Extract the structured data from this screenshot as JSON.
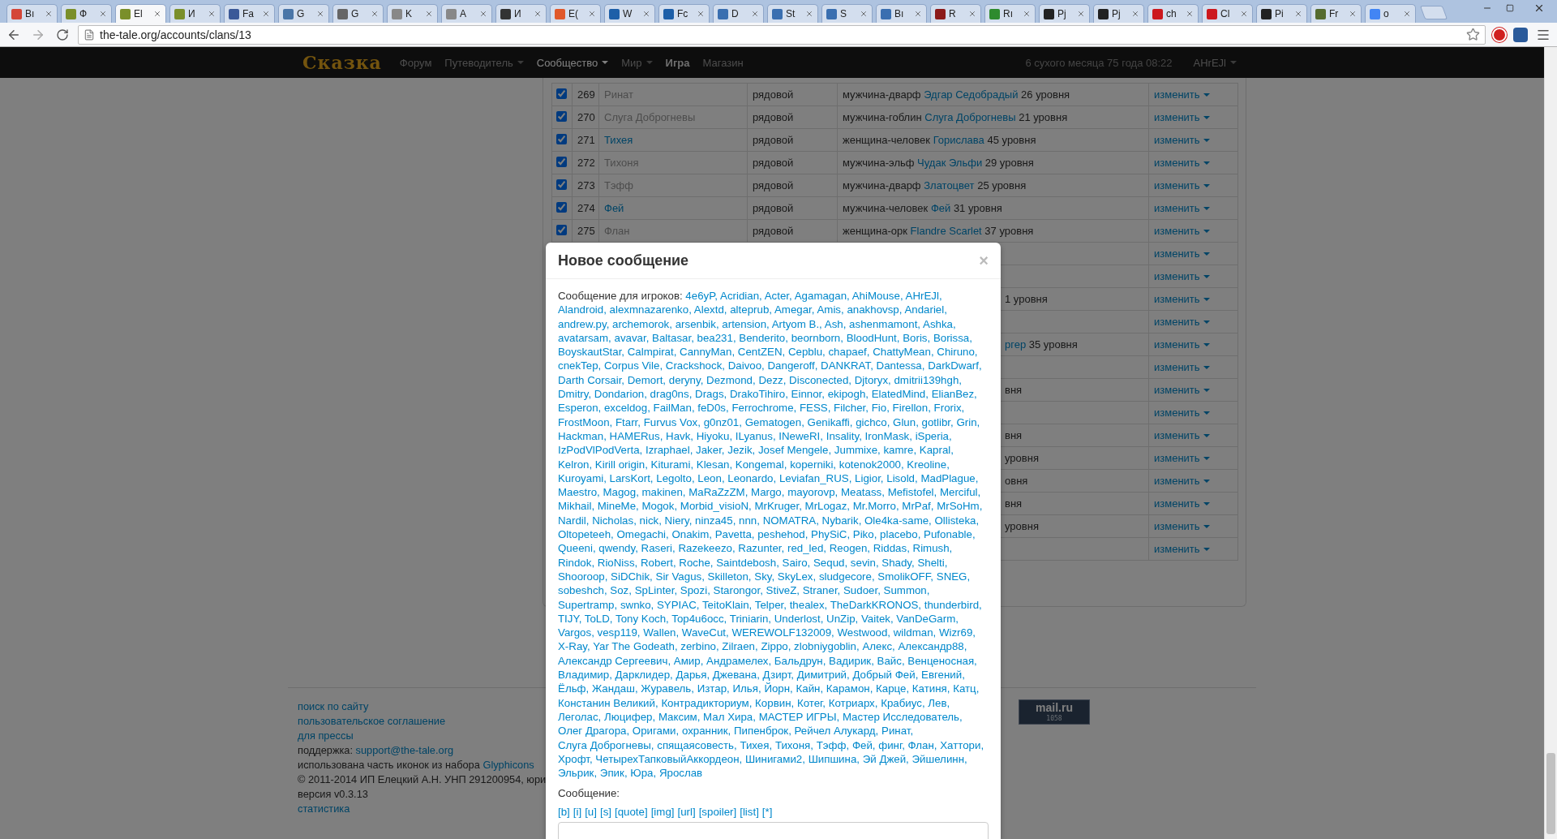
{
  "browser": {
    "tabs": [
      {
        "title": "Bı",
        "color": "#d44638",
        "selected": false
      },
      {
        "title": "Ф",
        "color": "#7a8f2a",
        "selected": false
      },
      {
        "title": "El",
        "color": "#7a8f2a",
        "selected": true
      },
      {
        "title": "И",
        "color": "#7a8f2a",
        "selected": false
      },
      {
        "title": "Fa",
        "color": "#3b5998",
        "selected": false
      },
      {
        "title": "G",
        "color": "#4a76a8",
        "selected": false
      },
      {
        "title": "G",
        "color": "#666666",
        "selected": false
      },
      {
        "title": "K",
        "color": "#888888",
        "selected": false
      },
      {
        "title": "A",
        "color": "#888888",
        "selected": false
      },
      {
        "title": "И",
        "color": "#333333",
        "selected": false
      },
      {
        "title": "E(",
        "color": "#e0582a",
        "selected": false
      },
      {
        "title": "W",
        "color": "#1d5fa8",
        "selected": false
      },
      {
        "title": "Fc",
        "color": "#1d5fa8",
        "selected": false
      },
      {
        "title": "D",
        "color": "#3a6fb0",
        "selected": false
      },
      {
        "title": "St",
        "color": "#3a6fb0",
        "selected": false
      },
      {
        "title": "S",
        "color": "#3a6fb0",
        "selected": false
      },
      {
        "title": "Bı",
        "color": "#3a6fb0",
        "selected": false
      },
      {
        "title": "R",
        "color": "#8b1a1a",
        "selected": false
      },
      {
        "title": "Rı",
        "color": "#2e8b2e",
        "selected": false
      },
      {
        "title": "Pj",
        "color": "#222222",
        "selected": false
      },
      {
        "title": "Pj",
        "color": "#222222",
        "selected": false
      },
      {
        "title": "ch",
        "color": "#cc181e",
        "selected": false
      },
      {
        "title": "Cl",
        "color": "#cc181e",
        "selected": false
      },
      {
        "title": "Pi",
        "color": "#222222",
        "selected": false
      },
      {
        "title": "Fr",
        "color": "#556b2f",
        "selected": false
      },
      {
        "title": "o",
        "color": "#4285f4",
        "selected": false
      }
    ],
    "url": "the-tale.org/accounts/clans/13"
  },
  "nav": {
    "logo": "Сказка",
    "items": [
      {
        "label": "Форум",
        "dropdown": false,
        "selected": false,
        "emphasis": false
      },
      {
        "label": "Путеводитель",
        "dropdown": true,
        "selected": false,
        "emphasis": false
      },
      {
        "label": "Сообщество",
        "dropdown": true,
        "selected": true,
        "emphasis": false
      },
      {
        "label": "Мир",
        "dropdown": true,
        "selected": false,
        "emphasis": false
      },
      {
        "label": "Игра",
        "dropdown": false,
        "selected": false,
        "emphasis": true
      },
      {
        "label": "Магазин",
        "dropdown": false,
        "selected": false,
        "emphasis": false
      }
    ],
    "date": "6 сухого месяца 75 года 08:22",
    "user": "AHrEJl"
  },
  "members": [
    {
      "kind": "full",
      "checked": true,
      "number": "269",
      "name": "Ринат",
      "linked": false,
      "rank": "рядовой",
      "race": "мужчина-дварф",
      "hero": "Эдгар Седобрадый",
      "level": "26 уровня",
      "action": "изменить"
    },
    {
      "kind": "full",
      "checked": true,
      "number": "270",
      "name": "Слуга Доброгневы",
      "linked": false,
      "rank": "рядовой",
      "race": "мужчина-гоблин",
      "hero": "Слуга Доброгневы",
      "level": "21 уровня",
      "action": "изменить"
    },
    {
      "kind": "full",
      "checked": true,
      "number": "271",
      "name": "Тихея",
      "linked": true,
      "rank": "рядовой",
      "race": "женщина-человек",
      "hero": "Горислава",
      "level": "45 уровня",
      "action": "изменить"
    },
    {
      "kind": "full",
      "checked": true,
      "number": "272",
      "name": "Тихоня",
      "linked": false,
      "rank": "рядовой",
      "race": "мужчина-эльф",
      "hero": "Чудак Эльфи",
      "level": "29 уровня",
      "action": "изменить"
    },
    {
      "kind": "full",
      "checked": true,
      "number": "273",
      "name": "Тэфф",
      "linked": false,
      "rank": "рядовой",
      "race": "мужчина-дварф",
      "hero": "Златоцвет",
      "level": "25 уровня",
      "action": "изменить"
    },
    {
      "kind": "full",
      "checked": true,
      "number": "274",
      "name": "Фей",
      "linked": true,
      "rank": "рядовой",
      "race": "мужчина-человек",
      "hero": "Фей",
      "level": "31 уровня",
      "action": "изменить"
    },
    {
      "kind": "full",
      "checked": true,
      "number": "275",
      "name": "Флан",
      "linked": false,
      "rank": "рядовой",
      "race": "женщина-орк",
      "hero": "Flandre Scarlet",
      "level": "37 уровня",
      "action": "изменить"
    },
    {
      "kind": "covered",
      "action": "изменить"
    },
    {
      "kind": "covered",
      "action": "изменить"
    },
    {
      "kind": "covered",
      "tail": "1 уровня",
      "action": "изменить"
    },
    {
      "kind": "covered",
      "action": "изменить"
    },
    {
      "kind": "covered",
      "tail_link": "ргер",
      "tail": "35 уровня",
      "action": "изменить"
    },
    {
      "kind": "covered",
      "action": "изменить"
    },
    {
      "kind": "covered",
      "tail": "вня",
      "action": "изменить"
    },
    {
      "kind": "covered",
      "action": "изменить"
    },
    {
      "kind": "covered",
      "tail": "вня",
      "action": "изменить"
    },
    {
      "kind": "covered",
      "tail": "уровня",
      "action": "изменить"
    },
    {
      "kind": "covered",
      "tail": "овня",
      "action": "изменить"
    },
    {
      "kind": "covered",
      "tail": "вня",
      "action": "изменить"
    },
    {
      "kind": "covered",
      "tail": "уровня",
      "action": "изменить"
    },
    {
      "kind": "covered",
      "action": "изменить"
    }
  ],
  "footer": {
    "lines": [
      {
        "kind": "link",
        "text": "поиск по сайту"
      },
      {
        "kind": "link",
        "text": "пользовательское соглашение"
      },
      {
        "kind": "link",
        "text": "для прессы"
      },
      {
        "kind": "mixed",
        "text": "поддержка:",
        "link": "support@the-tale.org"
      },
      {
        "kind": "mixed",
        "text": "использована часть иконок из набора",
        "link": "Glyphicons"
      },
      {
        "kind": "text",
        "text": "© 2011-2014 ИП Елецкий А.Н. УНП 291200954, юри"
      },
      {
        "kind": "text",
        "text": "версия v0.3.13"
      },
      {
        "kind": "link",
        "text": "статистика"
      }
    ],
    "counter": {
      "logo": "mail.ru",
      "count": "1058"
    }
  },
  "modal": {
    "title": "Новое сообщение",
    "close": "×",
    "recipients_label": "Сообщение для игроков:",
    "separator": ",",
    "recipients": [
      "4e6yP",
      "Acridian",
      "Acter",
      "Agamagan",
      "AhiMouse",
      "AHrEJl",
      "Alandroid",
      "alexmnazarenko",
      "Alextd",
      "alteprub",
      "Amegar",
      "Amis",
      "anakhovsp",
      "Andariel",
      "andrew.py",
      "archemorok",
      "arsenbik",
      "artension",
      "Artyom B.",
      "Ash",
      "ashenmamont",
      "Ashka",
      "avatarsam",
      "avavar",
      "Baltasar",
      "bea231",
      "Benderito",
      "beornborn",
      "BloodHunt",
      "Boris",
      "Borissa",
      "BoyskautStar",
      "Calmpirat",
      "CannyMan",
      "CentZEN",
      "Cepblu",
      "chapaef",
      "ChattyMean",
      "Chiruno",
      "cnekTep",
      "Corpus Vile",
      "Crackshock",
      "Daivoo",
      "Dangeroff",
      "DANKRAT",
      "Dantessa",
      "DarkDwarf",
      "Darth Corsair",
      "Demort",
      "deryny",
      "Dezmond",
      "Dezz",
      "Disconected",
      "Djtoryx",
      "dmitrii139hgh",
      "Dmitry",
      "Dondarion",
      "drag0ns",
      "Drags",
      "DrakoTihiro",
      "Einnor",
      "ekipogh",
      "ElatedMind",
      "ElianBez",
      "Esperon",
      "exceldog",
      "FailMan",
      "feD0s",
      "Ferrochrome",
      "FESS",
      "Filcher",
      "Fio",
      "Firellon",
      "Frorix",
      "FrostMoon",
      "Ftarr",
      "Furvus Vox",
      "g0nz01",
      "Gematogen",
      "Genikaffi",
      "gichco",
      "Glun",
      "gotlibr",
      "Grin",
      "Hackman",
      "HAMERus",
      "Havk",
      "Hiyoku",
      "ILyanus",
      "INeweRI",
      "Insality",
      "IronMask",
      "iSperia",
      "IzPodVlPodVerta",
      "Izraphael",
      "Jaker",
      "Jezik",
      "Josef Mengele",
      "Jummixe",
      "kamre",
      "Kapral",
      "Kelron",
      "Kirill origin",
      "Kiturami",
      "Klesan",
      "Kongemal",
      "koperniki",
      "kotenok2000",
      "Kreoline",
      "Kuroyami",
      "LarsKort",
      "Legolto",
      "Leon",
      "Leonardo",
      "Leviafan_RUS",
      "Ligior",
      "Lisold",
      "MadPlague",
      "Maestro",
      "Magog",
      "makinen",
      "MaRaZzZM",
      "Margo",
      "mayorovp",
      "Meatass",
      "Mefistofel",
      "Merciful",
      "Mikhail",
      "MineMe",
      "Mogok",
      "Morbid_visioN",
      "MrKruger",
      "MrLogaz",
      "Mr.Morro",
      "MrPaf",
      "MrSoHm",
      "Nardil",
      "Nicholas",
      "nick",
      "Niery",
      "ninza45",
      "nnn",
      "NOMATRA",
      "Nybarik",
      "Ole4ka-same",
      "Ollisteka",
      "Oltopeteeh",
      "Omegachi",
      "Onakim",
      "Pavetta",
      "peshehod",
      "PhySiC",
      "Piko",
      "placebo",
      "Pufonable",
      "Queeni",
      "qwendy",
      "Raseri",
      "Razekeezo",
      "Razunter",
      "red_led",
      "Reogen",
      "Riddas",
      "Rimush",
      "Rindok",
      "RioNiss",
      "Robert",
      "Roche",
      "Saintdebosh",
      "Sairo",
      "Sequd",
      "sevin",
      "Shady",
      "Shelti",
      "Shooroop",
      "SiDChik",
      "Sir Vagus",
      "Skilleton",
      "Sky",
      "SkyLex",
      "sludgecore",
      "SmolikOFF",
      "SNEG",
      "sobeshch",
      "Soz",
      "SpLinter",
      "Spozi",
      "Starongor",
      "StiveZ",
      "Straner",
      "Sudoer",
      "Summon",
      "Supertramp",
      "swnko",
      "SYPIAC",
      "TeitoKlain",
      "Telper",
      "thealex",
      "TheDarkKRONOS",
      "thunderbird",
      "TIJY",
      "ToLD",
      "Tony Koch",
      "Top4u6occ",
      "Triniarin",
      "Underlost",
      "UnZip",
      "Vaitek",
      "VanDeGarm",
      "Vargos",
      "vesp119",
      "Wallen",
      "WaveCut",
      "WEREWOLF132009",
      "Westwood",
      "wildman",
      "Wizr69",
      "X-Ray",
      "Yar The Godeath",
      "zerbino",
      "Zilraen",
      "Zippo",
      "zlobniygoblin",
      "Алекс",
      "Александр88",
      "Александр Сергеевич",
      "Амир",
      "Андрамелех",
      "Бальдрун",
      "Вадирик",
      "Вайс",
      "Венценосная",
      "Владимир",
      "Дарклидер",
      "Дарья",
      "Джевана",
      "Дзирт",
      "Димитрий",
      "Добрый Фей",
      "Евгений",
      "Ёльф",
      "Жандаш",
      "Журавель",
      "Изтар",
      "Илья",
      "Йорн",
      "Кайн",
      "Карамон",
      "Карце",
      "Катиня",
      "Катц",
      "Констанин Великий",
      "Контрадикториум",
      "Корвин",
      "Котег",
      "Котриарх",
      "Крабиус",
      "Лев",
      "Леголас",
      "Люцифер",
      "Максим",
      "Мал Хира",
      "МАСТЕР ИГРЫ",
      "Мастер Исследователь",
      "Олег Драгора",
      "Оригами",
      "охранник",
      "Пипенброк",
      "Рейчел Алукард",
      "Ринат",
      "Слуга Доброгневы",
      "спящаясовесть",
      "Тихея",
      "Тихоня",
      "Тэфф",
      "Фей",
      "финг",
      "Флан",
      "Хаттори",
      "Хрофт",
      "ЧетырехТапковыйАккордеон",
      "Шинигами2",
      "Шипшина",
      "Эй Джей",
      "Эйшелинн",
      "Эльрик",
      "Эпик",
      "Юра",
      "Ярослав"
    ],
    "message_label": "Сообщение:",
    "bbcodes": [
      "[b]",
      "[i]",
      "[u]",
      "[s]",
      "[quote]",
      "[img]",
      "[url]",
      "[spoiler]",
      "[list]",
      "[*]"
    ]
  }
}
